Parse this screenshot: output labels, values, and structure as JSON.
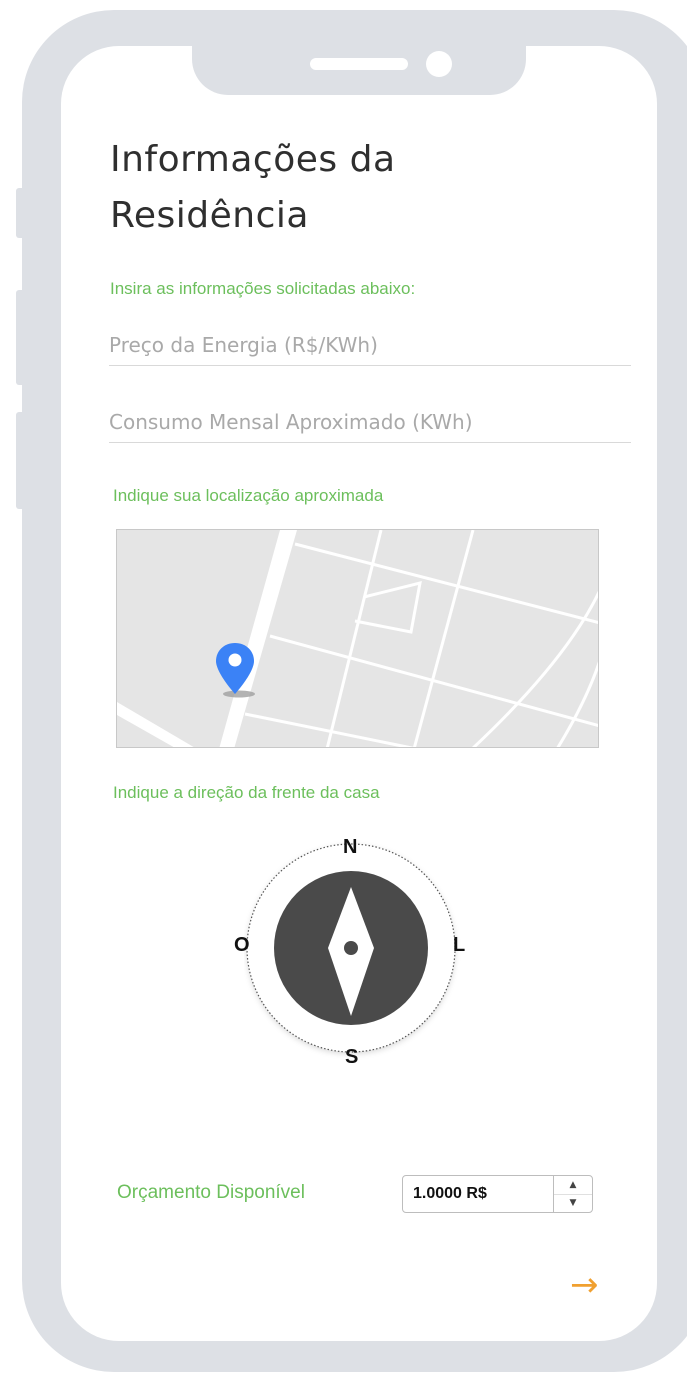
{
  "page": {
    "title": "Informações da Residência",
    "subtitle": "Insira as informações solicitadas abaixo:"
  },
  "form": {
    "energy_price": {
      "placeholder": "Preço da Energia (R$/KWh)",
      "value": ""
    },
    "monthly_consumption": {
      "placeholder": "Consumo Mensal Aproximado (KWh)",
      "value": ""
    }
  },
  "location": {
    "label": "Indique sua localização aproximada"
  },
  "direction": {
    "label": "Indique a direção da frente da casa",
    "north": "N",
    "south": "S",
    "east": "L",
    "west": "O"
  },
  "budget": {
    "label": "Orçamento Disponível",
    "value": "1.0000 R$"
  },
  "icons": {
    "map_pin": "map-pin-icon",
    "compass_needle": "compass-needle-icon",
    "next_arrow": "arrow-right-icon"
  },
  "colors": {
    "accent_green": "#6cbf5c",
    "next_arrow": "#f0a030",
    "map_pin": "#3b82f6",
    "compass_dark": "#4a4a4a",
    "device_frame": "#dde0e5"
  }
}
